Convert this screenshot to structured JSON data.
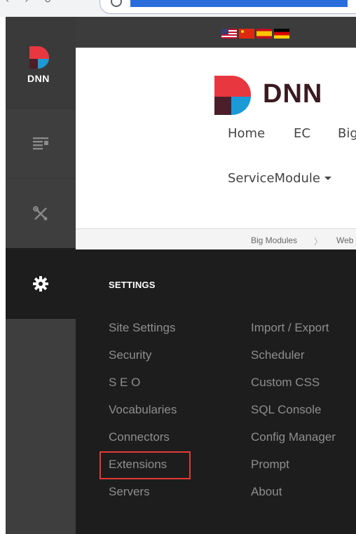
{
  "persona_bar": {
    "logo_text": "DNN",
    "items": [
      {
        "name": "content",
        "icon": "content-icon"
      },
      {
        "name": "manage",
        "icon": "tools-icon"
      },
      {
        "name": "settings",
        "icon": "gear-icon"
      }
    ]
  },
  "topbar": {
    "flags": [
      "us-flag",
      "china-flag",
      "spain-flag",
      "germany-flag"
    ]
  },
  "site": {
    "logo_text": "DNN",
    "menu": {
      "home": "Home",
      "ec": "EC",
      "big": "Big",
      "service_module": "ServiceModule"
    },
    "breadcrumb": {
      "item1": "Big Modules",
      "separator": "〉",
      "item2": "Web"
    }
  },
  "settings_panel": {
    "heading": "SETTINGS",
    "left_items": [
      "Site Settings",
      "Security",
      "S E O",
      "Vocabularies",
      "Connectors",
      "Extensions",
      "Servers"
    ],
    "right_items": [
      "Import / Export",
      "Scheduler",
      "Custom CSS",
      "SQL Console",
      "Config Manager",
      "Prompt",
      "About"
    ],
    "highlighted_item": "Extensions"
  },
  "colors": {
    "persona_bg": "#3e3e3e",
    "panel_bg": "#1d1d1d",
    "menu_text": "#8e8e8e",
    "highlight": "#e53935",
    "dnn_red": "#e8373f",
    "dnn_blue": "#1a9bd7"
  }
}
